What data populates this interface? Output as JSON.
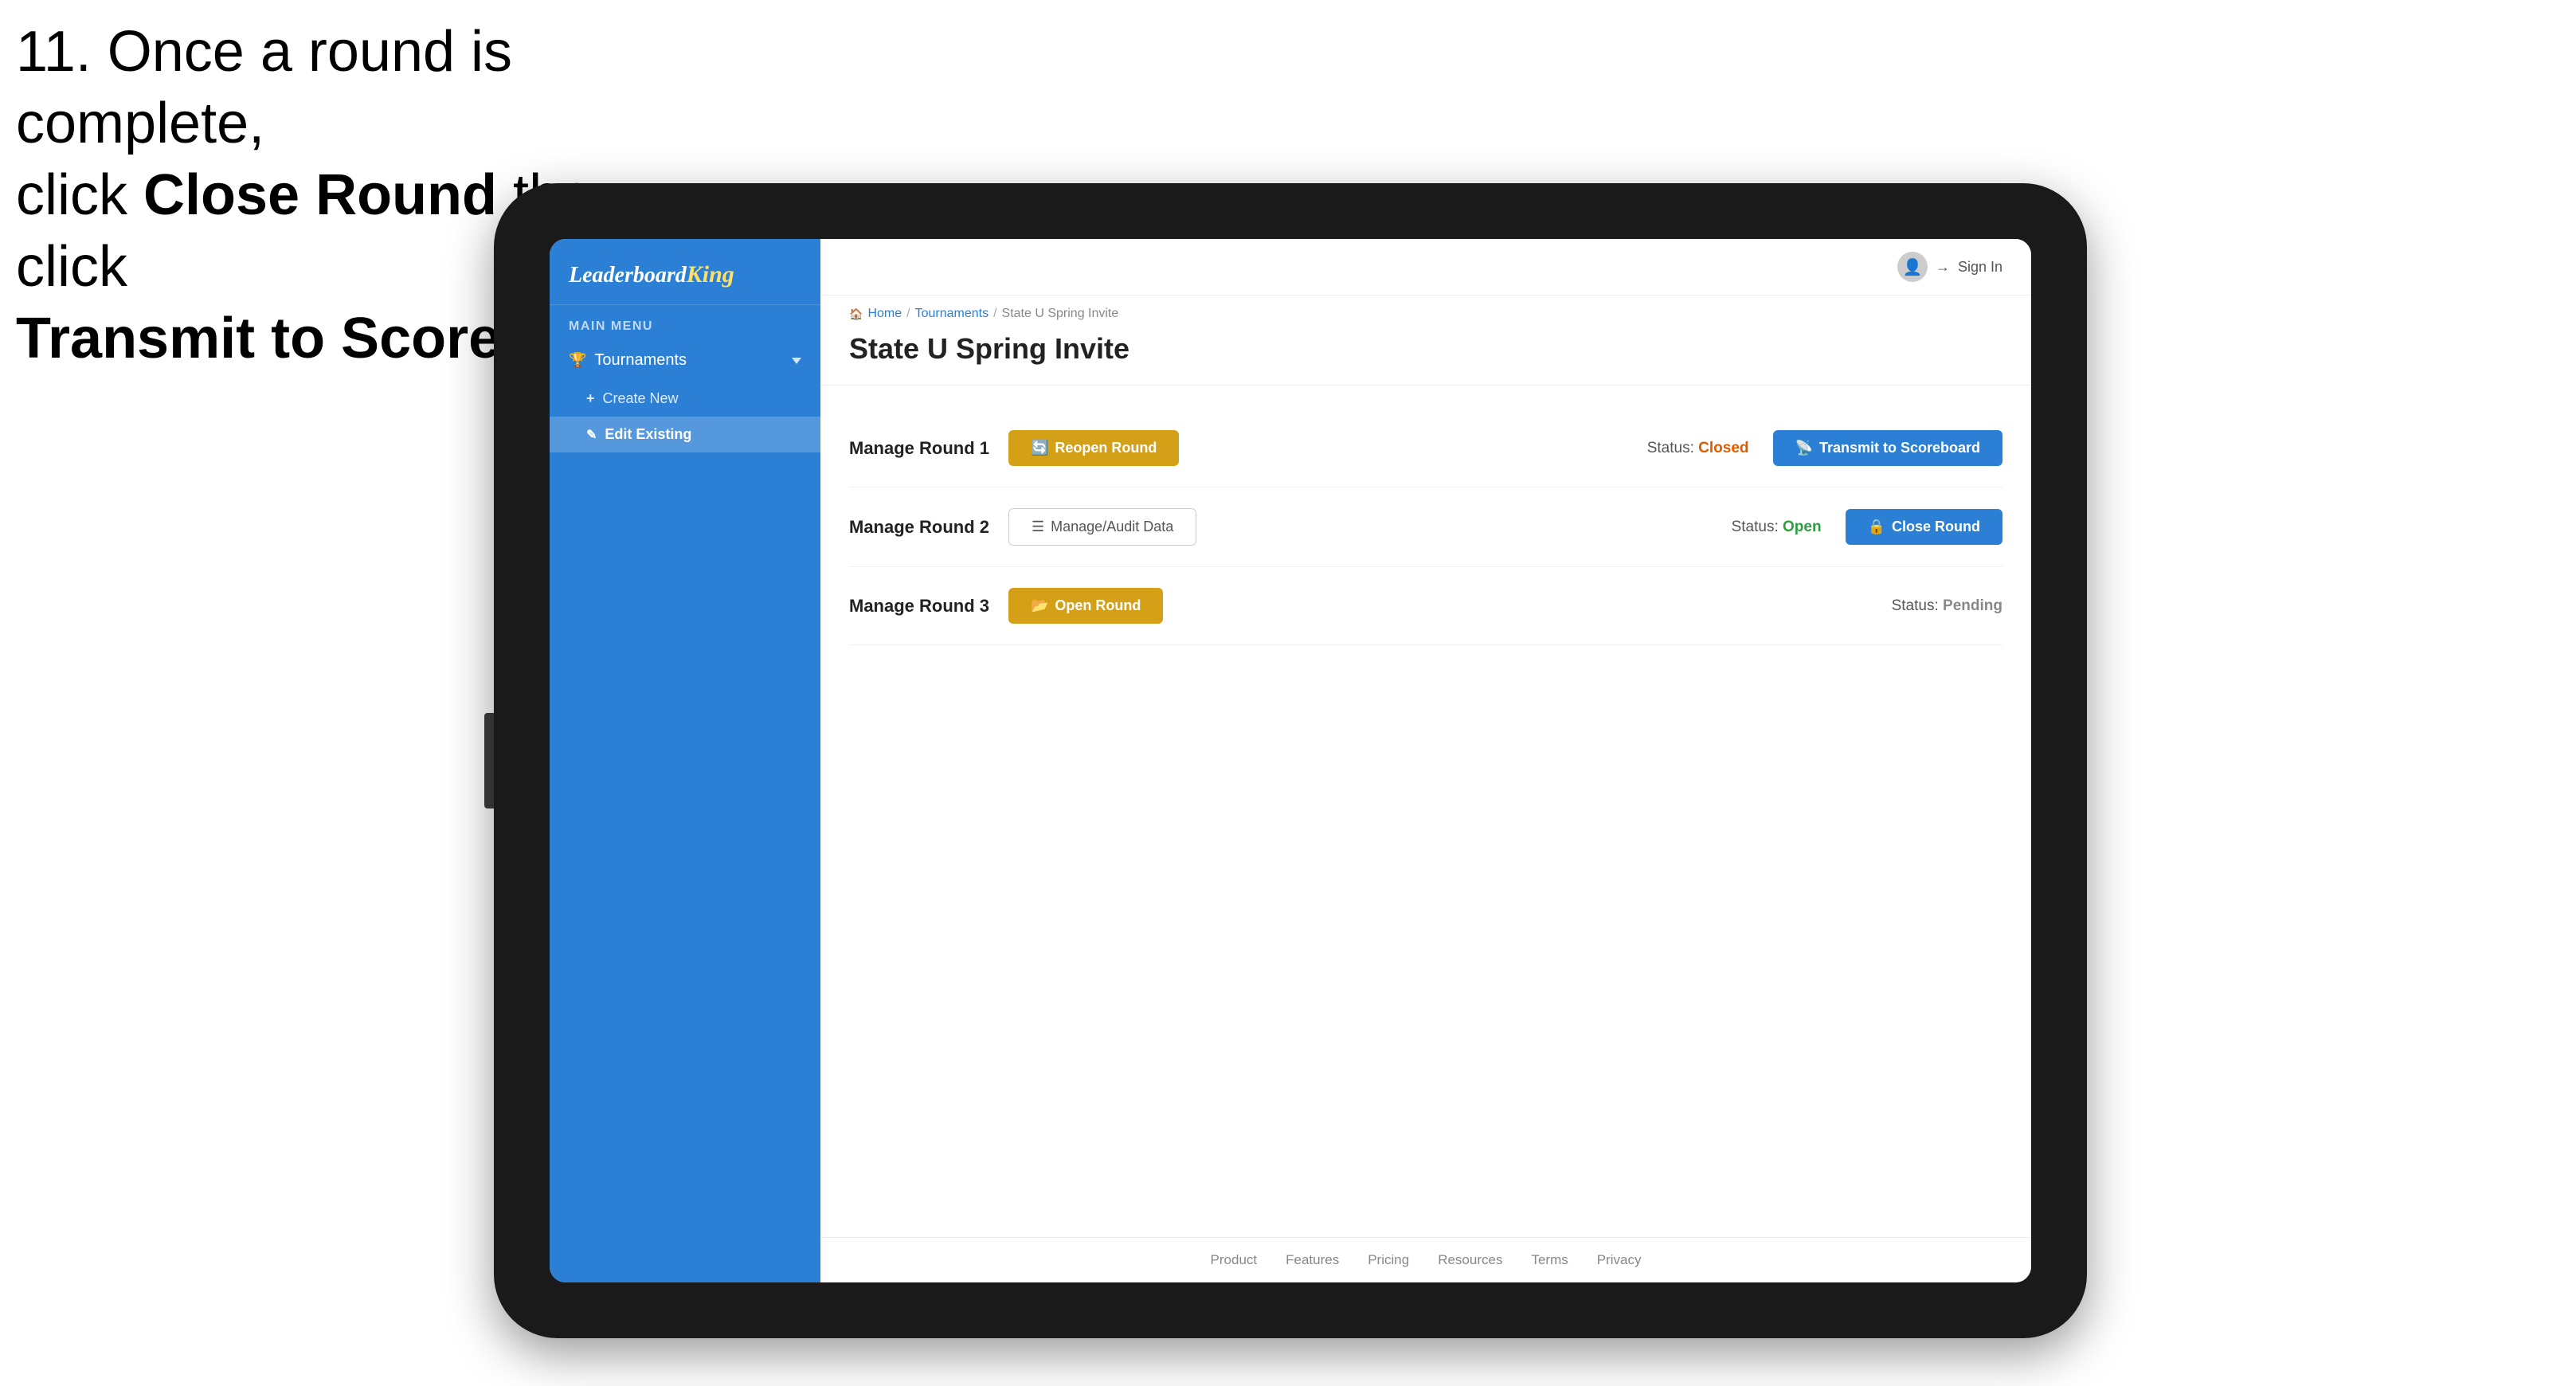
{
  "instruction": {
    "line1": "11. Once a round is complete,",
    "line2": "click ",
    "bold1": "Close Round",
    "line3": " then click",
    "bold2": "Transmit to Scoreboard."
  },
  "app": {
    "logo": {
      "prefix": "Leaderboard",
      "suffix": "King"
    },
    "mainMenuLabel": "MAIN MENU",
    "sidebar": {
      "items": [
        {
          "label": "Tournaments",
          "icon": "trophy"
        }
      ],
      "subItems": [
        {
          "label": "Create New",
          "icon": "plus"
        },
        {
          "label": "Edit Existing",
          "icon": "edit",
          "active": true
        }
      ]
    },
    "topBar": {
      "signInLabel": "Sign In"
    },
    "breadcrumb": {
      "home": "Home",
      "sep1": "/",
      "tournaments": "Tournaments",
      "sep2": "/",
      "current": "State U Spring Invite"
    },
    "pageTitle": "State U Spring Invite",
    "rounds": [
      {
        "id": 1,
        "title": "Manage Round 1",
        "statusLabel": "Status:",
        "statusValue": "Closed",
        "statusClass": "status-closed",
        "primaryButton": {
          "label": "Reopen Round",
          "style": "amber",
          "icon": "reopen"
        },
        "secondaryButton": {
          "label": "Transmit to Scoreboard",
          "style": "blue",
          "icon": "transmit"
        }
      },
      {
        "id": 2,
        "title": "Manage Round 2",
        "statusLabel": "Status:",
        "statusValue": "Open",
        "statusClass": "status-open",
        "primaryButton": {
          "label": "Manage/Audit Data",
          "style": "outline",
          "icon": "audit"
        },
        "secondaryButton": {
          "label": "Close Round",
          "style": "blue",
          "icon": "close"
        }
      },
      {
        "id": 3,
        "title": "Manage Round 3",
        "statusLabel": "Status:",
        "statusValue": "Pending",
        "statusClass": "status-pending",
        "primaryButton": {
          "label": "Open Round",
          "style": "amber",
          "icon": "open"
        },
        "secondaryButton": null
      }
    ],
    "footer": {
      "links": [
        "Product",
        "Features",
        "Pricing",
        "Resources",
        "Terms",
        "Privacy"
      ]
    }
  }
}
